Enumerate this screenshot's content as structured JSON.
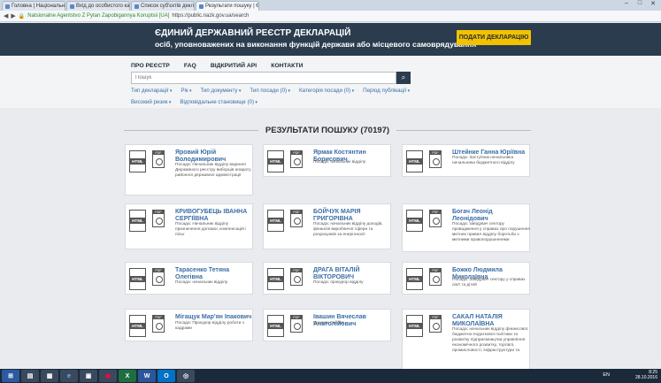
{
  "browser": {
    "tabs": [
      {
        "label": "Головна | Національне",
        "active": false
      },
      {
        "label": "Вхід до особистого кабінету",
        "active": false
      },
      {
        "label": "Список суб'єктів декл",
        "active": false
      },
      {
        "label": "Результати пошуку | ЄДР",
        "active": true
      }
    ],
    "address": {
      "org": "Natsionalne Agentstvo Z Pytan Zapobigannya Koruptsii [UA]",
      "url": "https://public.nazk.gov.ua/search"
    }
  },
  "header": {
    "title": "ЄДИНИЙ ДЕРЖАВНИЙ РЕЄСТР ДЕКЛАРАЦІЙ",
    "subtitle": "осіб, уповноважених на виконання функцій держави або місцевого самоврядування",
    "submit_label": "ПОДАТИ ДЕКЛАРАЦІЮ"
  },
  "nav": {
    "links": [
      "ПРО РЕЄСТР",
      "FAQ",
      "ВІДКРИТИЙ API",
      "КОНТАКТИ"
    ]
  },
  "search": {
    "placeholder": "Пошук"
  },
  "filters": {
    "row1": [
      "Тип декларації",
      "Рік",
      "Тип документу",
      "Тип посади (0)",
      "Категорія посади (0)",
      "Період публікації"
    ],
    "row2": [
      "Високий ризик",
      "Відповідальне становище (0)"
    ]
  },
  "results": {
    "title": "РЕЗУЛЬТАТИ ПОШУКУ (70197)",
    "html_label": "HTML",
    "cards": [
      {
        "name": "Яровий Юрій Володимирович",
        "position": "Посада: Начальник відділу ведення Державного реєстру виборців апарату районної державної адміністрації"
      },
      {
        "name": "Ярмак Костянтин Борисович",
        "position": "Посада: начальник відділу"
      },
      {
        "name": "Штейнке Ганна Юріївна",
        "position": "Посада: Заступник начальника начальника бюджетного відділу"
      },
      {
        "name": "КРИВОГУБЕЦЬ ІВАННА СЕРГІЇВНА",
        "position": "Посада: Начальник відділу призначення допомог, компенсацій і пільг"
      },
      {
        "name": "БОЙЧУК МАРІЯ ГРИГОРІВНА",
        "position": "Посада: начальник відділу доходів, фінансів виробничої сфери та розрахунків за енергоносії"
      },
      {
        "name": "Богач Леонід Леонідович",
        "position": "Посада: завідувач сектору провадження у справах про порушення митних правил відділу боротьби з митними правопорушеннями"
      },
      {
        "name": "Тарасенко Тетяна Олегівна",
        "position": "Посада: начальник відділу"
      },
      {
        "name": "ДРАГА ВІТАЛІЙ ВІКТОРОВИЧ",
        "position": "Посада: прокурор відділу"
      },
      {
        "name": "Божко Людмила Миколаївна",
        "position": "Посада: Завідувач сектору у справах сім'ї та дітей"
      },
      {
        "name": "Мігащук Мар'ян Іпакович",
        "position": "Посада: Прокурор відділу роботи з кадрами"
      },
      {
        "name": "Івашин Вячеслав Анатолійович",
        "position": "Посада: Голова"
      },
      {
        "name": "САКАЛ НАТАЛІЯ МИКОЛАЇВНА",
        "position": "Посада: начальник відділу фінансової, бюджетно-податкової політики та розвитку підприємництва управління економічного розвитку, торгівлі, промисловості, інфраструктури та"
      }
    ]
  },
  "taskbar": {
    "language": "EN",
    "time": "8:25",
    "date": "28.10.2016"
  },
  "colors": {
    "header_bg": "#2a3c4e",
    "accent_button": "#f2c200",
    "link": "#3b6ea5"
  }
}
